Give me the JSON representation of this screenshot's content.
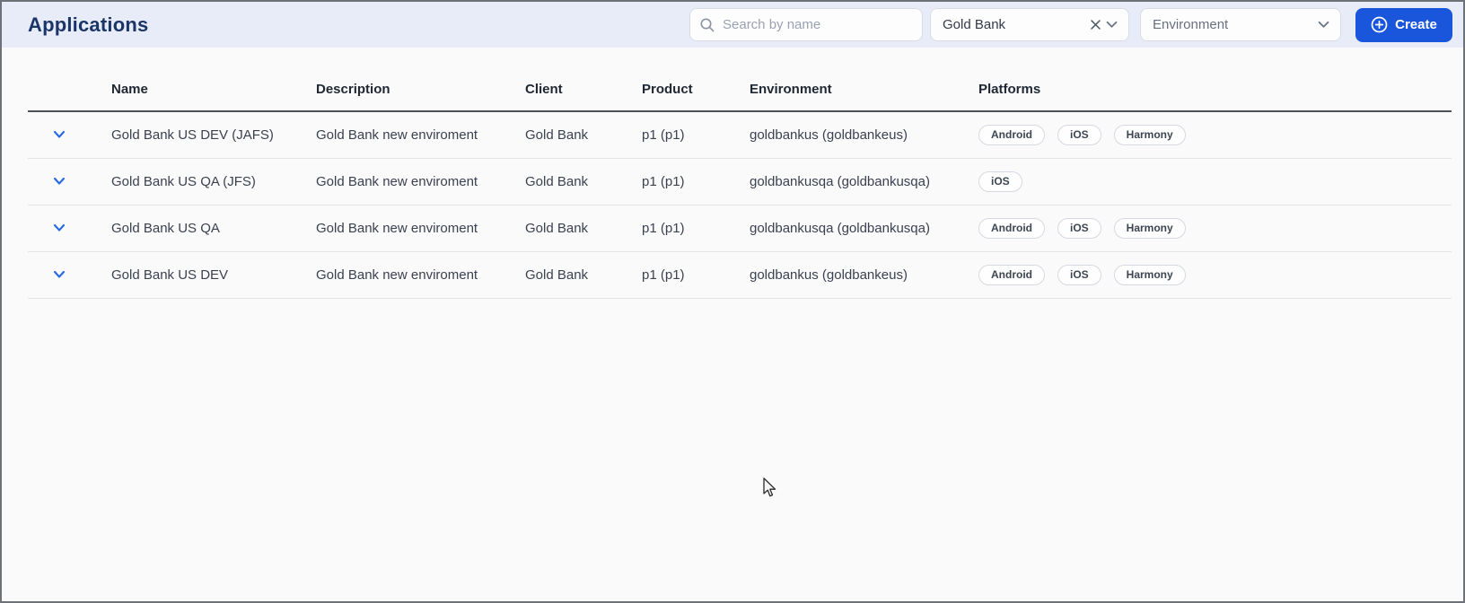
{
  "page": {
    "title": "Applications"
  },
  "toolbar": {
    "search": {
      "placeholder": "Search by name",
      "value": ""
    },
    "client_filter": {
      "value": "Gold Bank"
    },
    "environment_filter": {
      "placeholder": "Environment"
    },
    "create_label": "Create"
  },
  "table": {
    "columns": [
      "Name",
      "Description",
      "Client",
      "Product",
      "Environment",
      "Platforms"
    ],
    "rows": [
      {
        "name": "Gold Bank US DEV (JAFS)",
        "description": "Gold Bank new enviroment",
        "client": "Gold Bank",
        "product": "p1 (p1)",
        "environment": "goldbankus (goldbankeus)",
        "platforms": [
          "Android",
          "iOS",
          "Harmony"
        ]
      },
      {
        "name": "Gold Bank US QA (JFS)",
        "description": "Gold Bank new enviroment",
        "client": "Gold Bank",
        "product": "p1 (p1)",
        "environment": "goldbankusqa (goldbankusqa)",
        "platforms": [
          "iOS"
        ]
      },
      {
        "name": "Gold Bank US QA",
        "description": "Gold Bank new enviroment",
        "client": "Gold Bank",
        "product": "p1 (p1)",
        "environment": "goldbankusqa (goldbankusqa)",
        "platforms": [
          "Android",
          "iOS",
          "Harmony"
        ]
      },
      {
        "name": "Gold Bank US DEV",
        "description": "Gold Bank new enviroment",
        "client": "Gold Bank",
        "product": "p1 (p1)",
        "environment": "goldbankus (goldbankeus)",
        "platforms": [
          "Android",
          "iOS",
          "Harmony"
        ]
      }
    ]
  },
  "icons": {
    "search": "magnifier",
    "clear": "x-mark",
    "dropdown": "chevron-down",
    "create": "plus-circle",
    "row_expand": "chevron-down"
  },
  "colors": {
    "accent": "#1a56db",
    "appbar_bg": "#e7ecf8",
    "title": "#1b3568",
    "row_chevron": "#2468e5",
    "badge_border": "#d5d9e0",
    "header_rule": "#4e5156",
    "row_rule": "#e3e4e6"
  }
}
